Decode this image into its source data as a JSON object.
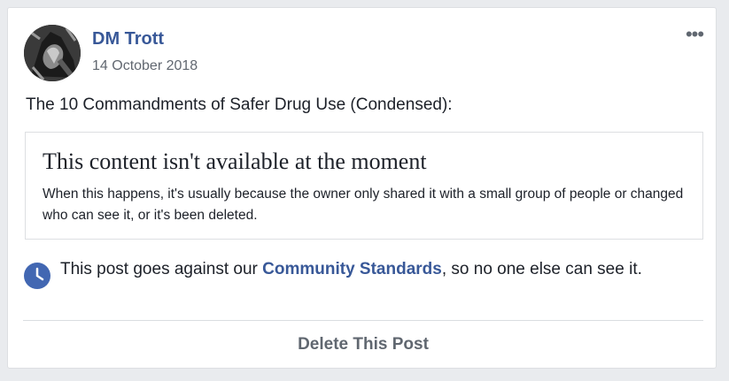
{
  "post": {
    "author": "DM Trott",
    "date": "14 October 2018",
    "text": "The 10 Commandments of Safer Drug Use (Condensed):",
    "more_icon": "more-options-icon"
  },
  "unavailable": {
    "title": "This content isn't available at the moment",
    "body": "When this happens, it's usually because the owner only shared it with a small group of people or changed who can see it, or it's been deleted."
  },
  "notice": {
    "icon": "clock-icon",
    "text_before": "This post goes against our ",
    "link": "Community Standards",
    "text_after": ", so no one else can see it."
  },
  "actions": {
    "delete_label": "Delete This Post"
  },
  "colors": {
    "link": "#385898",
    "icon_blue": "#4267b2"
  }
}
